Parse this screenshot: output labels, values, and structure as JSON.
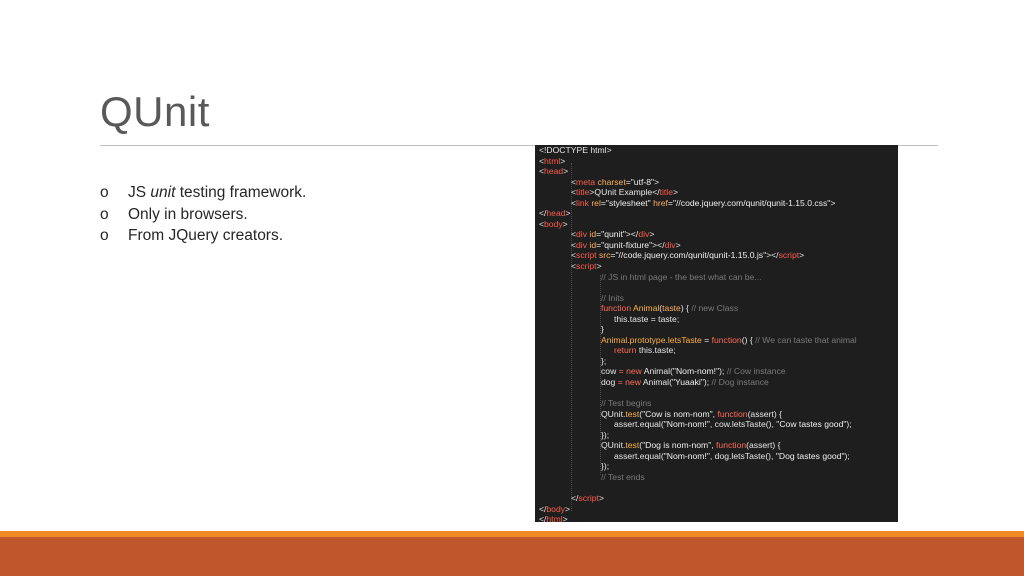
{
  "slide": {
    "title": "QUnit",
    "bullets": [
      {
        "marker": "o",
        "parts": [
          {
            "t": "JS "
          },
          {
            "t": "unit",
            "i": true
          },
          {
            "t": " testing framework."
          }
        ]
      },
      {
        "marker": "o",
        "parts": [
          {
            "t": "Only in browsers."
          }
        ]
      },
      {
        "marker": "o",
        "parts": [
          {
            "t": "From JQuery creators."
          }
        ]
      }
    ]
  },
  "colors": {
    "title": "#595959",
    "code_background": "#1e1e1e",
    "tag": "#ff5c4d",
    "attribute": "#ffb060",
    "comment": "#7a7a7a",
    "keyword": "#ff6a5a",
    "footer_accent": "#f08a24",
    "footer_bar": "#c0562b"
  },
  "code": {
    "language": "html",
    "lines": [
      {
        "indent": 0,
        "tokens": [
          [
            "txt",
            "<!DOCTYPE html>"
          ]
        ]
      },
      {
        "indent": 0,
        "tokens": [
          [
            "txt",
            "<"
          ],
          [
            "tag",
            "html"
          ],
          [
            "txt",
            ">"
          ]
        ]
      },
      {
        "indent": 0,
        "tokens": [
          [
            "txt",
            "<"
          ],
          [
            "tag",
            "head"
          ],
          [
            "txt",
            ">"
          ]
        ]
      },
      {
        "indent": 1,
        "tokens": [
          [
            "txt",
            "<"
          ],
          [
            "tag",
            "meta"
          ],
          [
            "attr",
            " charset"
          ],
          [
            "txt",
            "="
          ],
          [
            "str",
            "\"utf-8\""
          ],
          [
            "txt",
            ">"
          ]
        ]
      },
      {
        "indent": 1,
        "tokens": [
          [
            "txt",
            "<"
          ],
          [
            "tag",
            "title"
          ],
          [
            "txt",
            ">QUnit Example</"
          ],
          [
            "tag",
            "title"
          ],
          [
            "txt",
            ">"
          ]
        ]
      },
      {
        "indent": 1,
        "tokens": [
          [
            "txt",
            "<"
          ],
          [
            "tag",
            "link"
          ],
          [
            "attr",
            " rel"
          ],
          [
            "txt",
            "="
          ],
          [
            "str",
            "\"stylesheet\""
          ],
          [
            "attr",
            " href"
          ],
          [
            "txt",
            "="
          ],
          [
            "str",
            "\"//code.jquery.com/qunit/qunit-1.15.0.css\""
          ],
          [
            "txt",
            ">"
          ]
        ]
      },
      {
        "indent": 0,
        "tokens": [
          [
            "txt",
            "</"
          ],
          [
            "tag",
            "head"
          ],
          [
            "txt",
            ">"
          ]
        ]
      },
      {
        "indent": 0,
        "tokens": [
          [
            "txt",
            "<"
          ],
          [
            "tag",
            "body"
          ],
          [
            "txt",
            ">"
          ]
        ]
      },
      {
        "indent": 1,
        "tokens": [
          [
            "txt",
            "<"
          ],
          [
            "tag",
            "div"
          ],
          [
            "attr",
            " id"
          ],
          [
            "txt",
            "="
          ],
          [
            "str",
            "\"qunit\""
          ],
          [
            "txt",
            "></"
          ],
          [
            "tag",
            "div"
          ],
          [
            "txt",
            ">"
          ]
        ]
      },
      {
        "indent": 1,
        "tokens": [
          [
            "txt",
            "<"
          ],
          [
            "tag",
            "div"
          ],
          [
            "attr",
            " id"
          ],
          [
            "txt",
            "="
          ],
          [
            "str",
            "\"qunit-fixture\""
          ],
          [
            "txt",
            "></"
          ],
          [
            "tag",
            "div"
          ],
          [
            "txt",
            ">"
          ]
        ]
      },
      {
        "indent": 1,
        "tokens": [
          [
            "txt",
            "<"
          ],
          [
            "tag",
            "script"
          ],
          [
            "attr",
            " src"
          ],
          [
            "txt",
            "="
          ],
          [
            "str",
            "\"//code.jquery.com/qunit/qunit-1.15.0.js\""
          ],
          [
            "txt",
            "></"
          ],
          [
            "tag",
            "script"
          ],
          [
            "txt",
            ">"
          ]
        ]
      },
      {
        "indent": 1,
        "tokens": [
          [
            "txt",
            "<"
          ],
          [
            "tag",
            "script"
          ],
          [
            "txt",
            ">"
          ]
        ]
      },
      {
        "indent": 2,
        "tokens": [
          [
            "com",
            "// JS in html page - the best what can be..."
          ]
        ]
      },
      {
        "indent": 2,
        "tokens": []
      },
      {
        "indent": 2,
        "tokens": [
          [
            "com",
            "// Inits"
          ]
        ]
      },
      {
        "indent": 2,
        "tokens": [
          [
            "key",
            "function "
          ],
          [
            "fn",
            "Animal"
          ],
          [
            "txt",
            "("
          ],
          [
            "attr",
            "taste"
          ],
          [
            "txt",
            ") { "
          ],
          [
            "com",
            "// new Class"
          ]
        ]
      },
      {
        "indent": 3,
        "tokens": [
          [
            "txt",
            "this.taste = taste;"
          ]
        ]
      },
      {
        "indent": 2,
        "tokens": [
          [
            "txt",
            "}"
          ]
        ]
      },
      {
        "indent": 2,
        "tokens": [
          [
            "fn",
            "Animal.prototype.letsTaste"
          ],
          [
            "txt",
            " = "
          ],
          [
            "key",
            "function"
          ],
          [
            "txt",
            "() { "
          ],
          [
            "com",
            "// We can taste that animal"
          ]
        ]
      },
      {
        "indent": 3,
        "tokens": [
          [
            "key",
            "return "
          ],
          [
            "txt",
            "this.taste;"
          ]
        ]
      },
      {
        "indent": 2,
        "tokens": [
          [
            "txt",
            "};"
          ]
        ]
      },
      {
        "indent": 2,
        "tokens": [
          [
            "txt",
            "cow "
          ],
          [
            "key",
            "= new "
          ],
          [
            "txt",
            "Animal("
          ],
          [
            "str",
            "\"Nom-nom!\""
          ],
          [
            "txt",
            "); "
          ],
          [
            "com",
            "// Cow instance"
          ]
        ]
      },
      {
        "indent": 2,
        "tokens": [
          [
            "txt",
            "dog "
          ],
          [
            "key",
            "= new "
          ],
          [
            "txt",
            "Animal("
          ],
          [
            "str",
            "\"Yuaaki\""
          ],
          [
            "txt",
            "); "
          ],
          [
            "com",
            "// Dog instance"
          ]
        ]
      },
      {
        "indent": 2,
        "tokens": []
      },
      {
        "indent": 2,
        "tokens": [
          [
            "com",
            "// Test begins"
          ]
        ]
      },
      {
        "indent": 2,
        "tokens": [
          [
            "txt",
            "QUnit."
          ],
          [
            "fn",
            "test"
          ],
          [
            "txt",
            "("
          ],
          [
            "str",
            "\"Cow is nom-nom\""
          ],
          [
            "txt",
            ", "
          ],
          [
            "key",
            "function"
          ],
          [
            "txt",
            "(assert) {"
          ]
        ]
      },
      {
        "indent": 3,
        "tokens": [
          [
            "txt",
            "assert.equal("
          ],
          [
            "str",
            "\"Nom-nom!\""
          ],
          [
            "txt",
            ", cow.letsTaste(), "
          ],
          [
            "str",
            "\"Cow tastes good\""
          ],
          [
            "txt",
            ");"
          ]
        ]
      },
      {
        "indent": 2,
        "tokens": [
          [
            "txt",
            "});"
          ]
        ]
      },
      {
        "indent": 2,
        "tokens": [
          [
            "txt",
            "QUnit."
          ],
          [
            "fn",
            "test"
          ],
          [
            "txt",
            "("
          ],
          [
            "str",
            "\"Dog is nom-nom\""
          ],
          [
            "txt",
            ", "
          ],
          [
            "key",
            "function"
          ],
          [
            "txt",
            "(assert) {"
          ]
        ]
      },
      {
        "indent": 3,
        "tokens": [
          [
            "txt",
            "assert.equal("
          ],
          [
            "str",
            "\"Nom-nom!\""
          ],
          [
            "txt",
            ", dog.letsTaste(), "
          ],
          [
            "str",
            "\"Dog tastes good\""
          ],
          [
            "txt",
            ");"
          ]
        ]
      },
      {
        "indent": 2,
        "tokens": [
          [
            "txt",
            "});"
          ]
        ]
      },
      {
        "indent": 2,
        "tokens": [
          [
            "com",
            "// Test ends"
          ]
        ]
      },
      {
        "indent": 2,
        "tokens": []
      },
      {
        "indent": 1,
        "tokens": [
          [
            "txt",
            "</"
          ],
          [
            "tag",
            "script"
          ],
          [
            "txt",
            ">"
          ]
        ]
      },
      {
        "indent": 0,
        "tokens": [
          [
            "txt",
            "</"
          ],
          [
            "tag",
            "body"
          ],
          [
            "txt",
            ">"
          ]
        ]
      },
      {
        "indent": 0,
        "tokens": [
          [
            "txt",
            "</"
          ],
          [
            "tag",
            "html"
          ],
          [
            "txt",
            ">"
          ]
        ]
      }
    ]
  }
}
